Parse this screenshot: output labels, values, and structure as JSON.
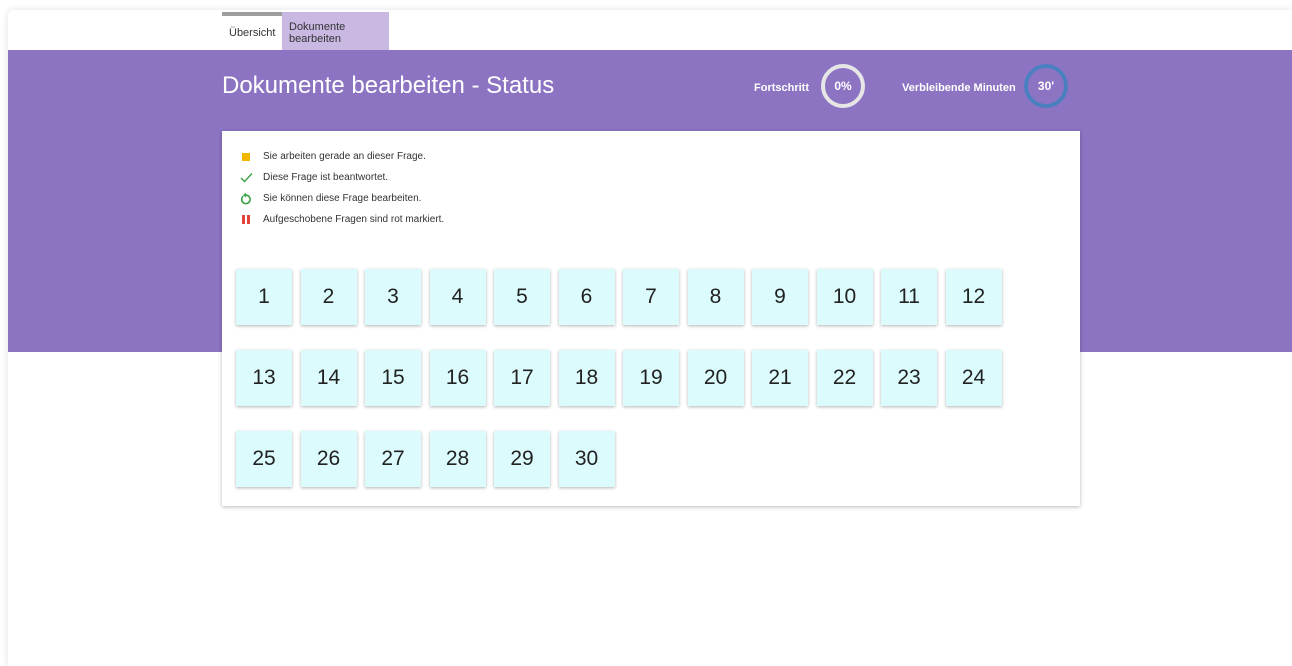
{
  "tabs": [
    {
      "label": "Übersicht"
    },
    {
      "label": "Dokumente bearbeiten"
    }
  ],
  "header": {
    "title": "Dokumente bearbeiten - Status",
    "progress_label": "Fortschritt",
    "progress_value": "0%",
    "minutes_label": "Verbleibende Minuten",
    "minutes_value": "30'"
  },
  "legend": [
    {
      "icon": "yellow-square-icon",
      "text": "Sie arbeiten gerade an dieser Frage."
    },
    {
      "icon": "checkmark-icon",
      "text": "Diese Frage ist beantwortet."
    },
    {
      "icon": "refresh-icon",
      "text": "Sie können diese Frage bearbeiten."
    },
    {
      "icon": "pause-icon",
      "text": "Aufgeschobene Fragen sind rot markiert."
    }
  ],
  "questions": [
    "1",
    "2",
    "3",
    "4",
    "5",
    "6",
    "7",
    "8",
    "9",
    "10",
    "11",
    "12",
    "13",
    "14",
    "15",
    "16",
    "17",
    "18",
    "19",
    "20",
    "21",
    "22",
    "23",
    "24",
    "25",
    "26",
    "27",
    "28",
    "29",
    "30"
  ],
  "colors": {
    "header_purple": "#8c74c3",
    "active_tab": "#c8b8e2",
    "question_tile": "#dcfbfc",
    "current_yellow": "#f2b600",
    "answered_green": "#3aa045",
    "deferred_red": "#e0443a",
    "timer_ring_blue": "#4a7fc0"
  }
}
